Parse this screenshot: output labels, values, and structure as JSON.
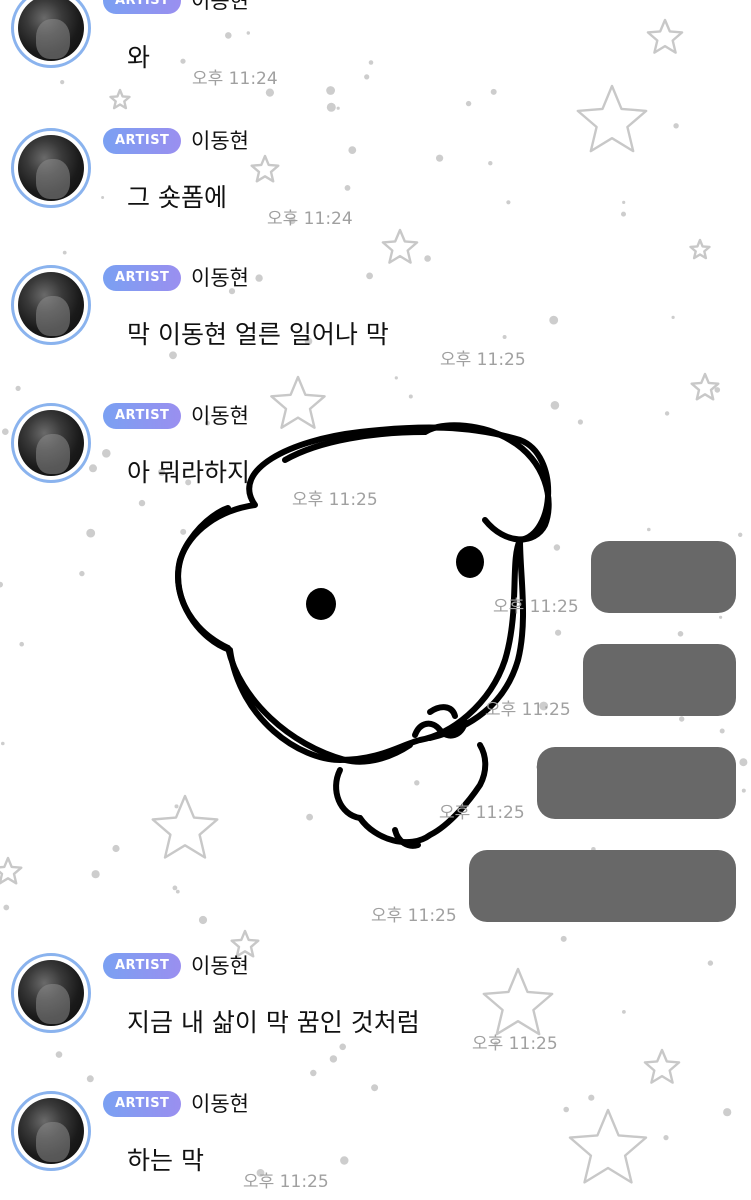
{
  "colors": {
    "badge_gradient_start": "#7aa0f2",
    "badge_gradient_end": "#9a8ff0",
    "avatar_ring": "#8ab3ee",
    "my_bubble": "#686868",
    "timestamp": "#a0a0a0"
  },
  "chat": {
    "artist_badge": "ARTIST",
    "incoming": [
      {
        "name": "이동현",
        "text": "와",
        "time": "오후 11:24"
      },
      {
        "name": "이동현",
        "text": "그 숏폼에",
        "time": "오후 11:24"
      },
      {
        "name": "이동현",
        "text": "막 이동현 얼른 일어나 막",
        "time": "오후 11:25"
      },
      {
        "name": "이동현",
        "text": "아 뭐라하지",
        "time": "오후 11:25"
      },
      {
        "name": "이동현",
        "text": "지금 내 삶이 막 꿈인 것처럼",
        "time": "오후 11:25"
      },
      {
        "name": "이동현",
        "text": "하는 막",
        "time": "오후 11:25"
      }
    ],
    "outgoing": [
      {
        "time": "오후 11:25"
      },
      {
        "time": "오후 11:25"
      },
      {
        "time": "오후 11:25"
      },
      {
        "time": "오후 11:25"
      }
    ]
  }
}
